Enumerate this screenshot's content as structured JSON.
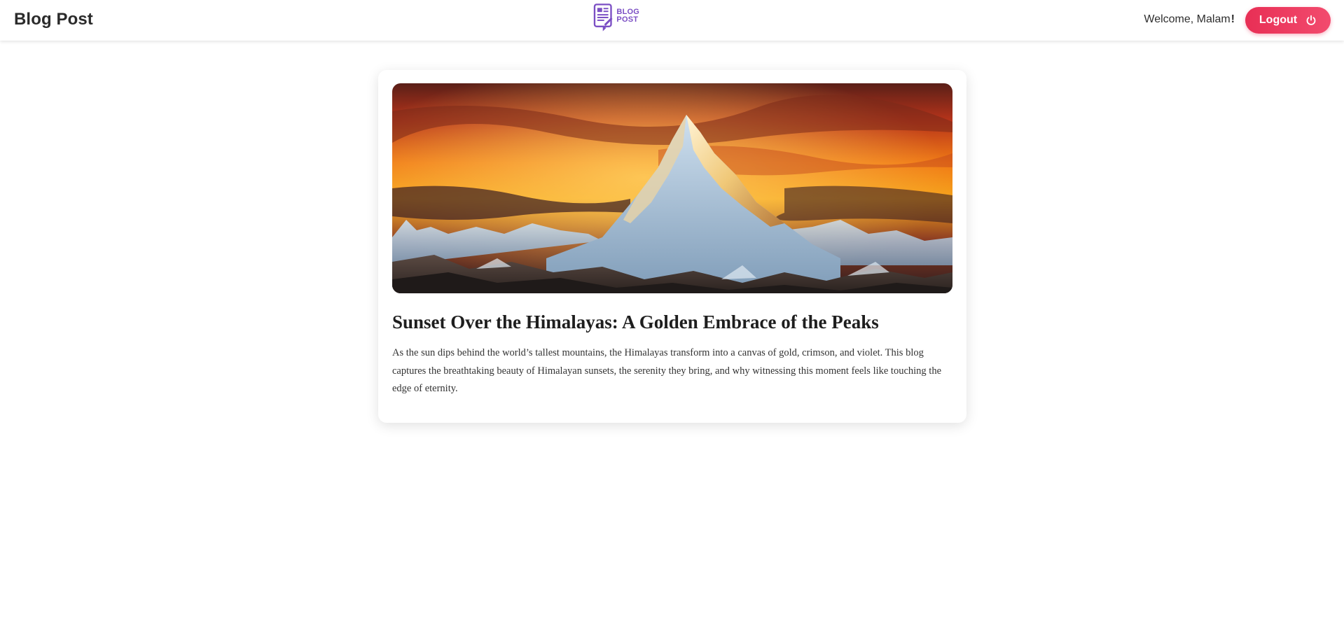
{
  "header": {
    "brand_title": "Blog Post",
    "logo": {
      "icon": "blog-post-logo-icon",
      "line1": "BLOG",
      "line2": "POST",
      "color": "#7b4fc4"
    },
    "welcome_text": "Welcome, Malam",
    "welcome_mark": "!",
    "logout_label": "Logout",
    "logout_icon": "power-icon",
    "accent_color": "#e82f55"
  },
  "post": {
    "image_alt": "Snow-capped Himalayan peak at sunset under a fiery orange sky",
    "title": "Sunset Over the Himalayas: A Golden Embrace of the Peaks",
    "body": "As the sun dips behind the world’s tallest mountains, the Himalayas transform into a canvas of gold, crimson, and violet. This blog captures the breathtaking beauty of Himalayan sunsets, the serenity they bring, and why witnessing this moment feels like touching the edge of eternity."
  }
}
